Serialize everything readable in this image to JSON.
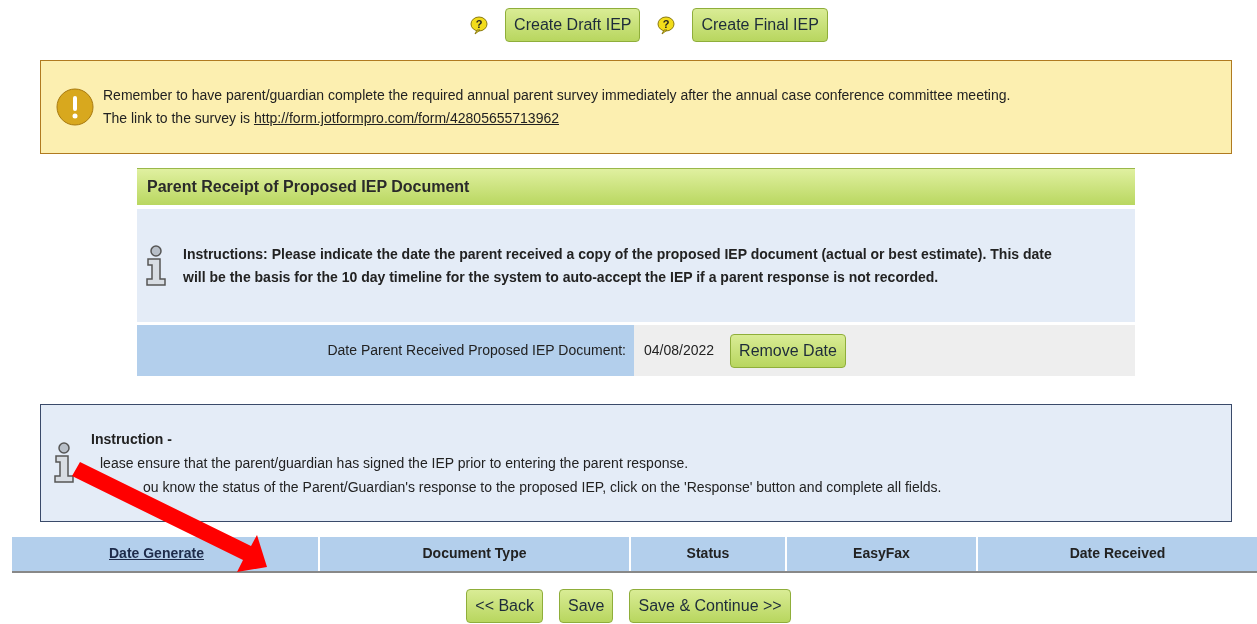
{
  "top_actions": [
    {
      "help": "?",
      "label": "Create Draft IEP"
    },
    {
      "help": "?",
      "label": "Create Final IEP"
    }
  ],
  "alert": {
    "message": "Remember to have parent/guardian complete the required annual parent survey immediately after the annual case conference committee meeting.",
    "link_prefix": "The link to the survey is ",
    "link": "http://form.jotformpro.com/form/42805655713962"
  },
  "section": {
    "title": "Parent Receipt of Proposed IEP Document",
    "instructions": "Instructions: Please indicate the date the parent received a copy of the proposed IEP document (actual or best estimate). This date will be the basis for the 10 day timeline for the system to auto-accept the IEP if a parent response is not recorded.",
    "field_label": "Date Parent Received Proposed IEP Document:",
    "field_value": "04/08/2022",
    "button": "Remove Date"
  },
  "instruction": {
    "title": "Instruction -",
    "lines": [
      "lease ensure that the parent/guardian has signed the IEP prior to entering the parent response.",
      "ou know the status of the Parent/Guardian's response to the proposed IEP, click on the 'Response' button and complete all fields."
    ]
  },
  "table": {
    "columns": [
      {
        "label": "Date Generate",
        "sortable": true
      },
      {
        "label": "Document Type",
        "sortable": false
      },
      {
        "label": "Status",
        "sortable": false
      },
      {
        "label": "EasyFax",
        "sortable": false
      },
      {
        "label": "Date Received",
        "sortable": false
      }
    ]
  },
  "buttons": [
    "<< Back",
    "Save",
    "Save & Continue >>"
  ],
  "annotation": {
    "kind": "arrow"
  }
}
